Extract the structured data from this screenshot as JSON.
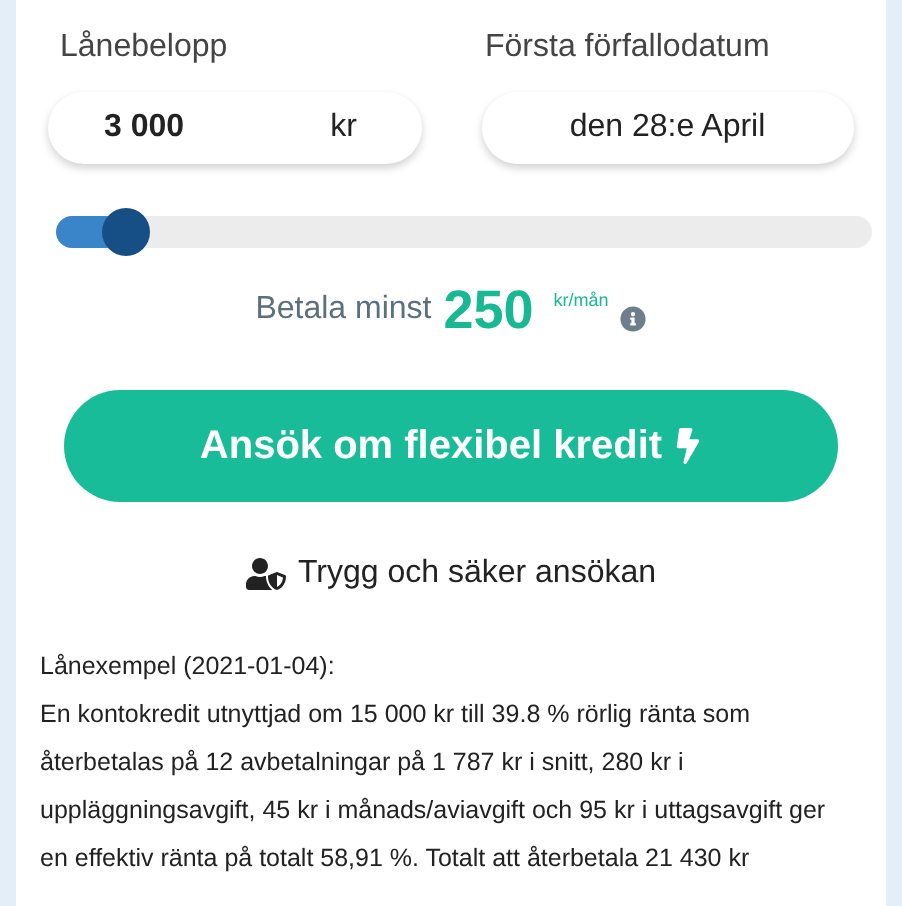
{
  "loan_amount": {
    "label": "Lånebelopp",
    "value": "3 000",
    "unit": "kr"
  },
  "first_due_date": {
    "label": "Första förfallodatum",
    "value": "den 28:e April"
  },
  "amount_slider": {
    "level": 0.08
  },
  "minimum_payment": {
    "prefix": "Betala minst",
    "amount": "250",
    "unit": "kr/mån"
  },
  "apply_button": {
    "label": "Ansök om flexibel kredit"
  },
  "security_note": "Trygg och säker ansökan",
  "loan_example": {
    "title": "Lånexempel (2021-01-04):",
    "text": "En kontokredit utnyttjad om 15 000 kr till 39.8 % rörlig ränta som återbetalas på 12 avbetalningar på 1 787 kr i snitt, 280 kr i uppläggningsavgift, 45 kr i månads/aviavgift och 95 kr i uttagsavgift ger en effektiv ränta på totalt 58,91 %. Totalt att återbetala 21 430 kr"
  }
}
